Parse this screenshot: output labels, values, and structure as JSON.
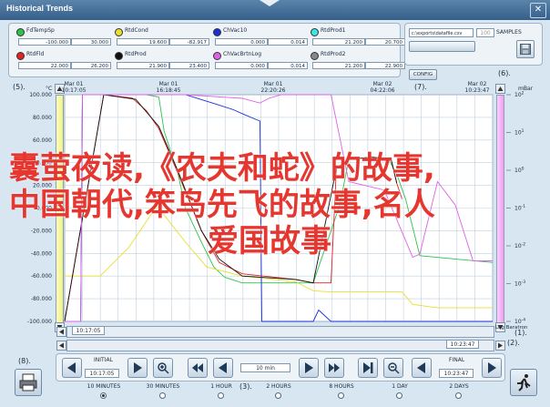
{
  "window": {
    "title": "Historical Trends",
    "close_glyph": "✕"
  },
  "pens": [
    {
      "name": "FdTempSp",
      "color": "#2cc44a",
      "v1": "-100.000",
      "v2": "30.000"
    },
    {
      "name": "RtdCond",
      "color": "#e8e02c",
      "v1": "19.600",
      "v2": "-82.917"
    },
    {
      "name": "ChVac10",
      "color": "#1c2fd6",
      "v1": "0.000",
      "v2": "0.014"
    },
    {
      "name": "RtdProd1",
      "color": "#3de4e4",
      "v1": "21.200",
      "v2": "20.700"
    },
    {
      "name": "RtdFld",
      "color": "#e02424",
      "v1": "22.000",
      "v2": "26.200"
    },
    {
      "name": "RtdProd",
      "color": "#111111",
      "v1": "21.900",
      "v2": "23.400"
    },
    {
      "name": "ChVacBrtnLog",
      "color": "#e060e8",
      "v1": "0.000",
      "v2": "0.014"
    },
    {
      "name": "RtdProd2",
      "color": "#888888",
      "v1": "21.200",
      "v2": "22.900"
    }
  ],
  "export": {
    "path": "c:\\exports\\datafile.csv",
    "samples_value": "100",
    "samples_label": "SAMPLES"
  },
  "config_label": "CONFIG",
  "callouts": {
    "c1": "(1).",
    "c2": "(2).",
    "c3": "(3).",
    "c5": "(5).",
    "c6": "(6).",
    "c7": "(7).",
    "c8": "(8)."
  },
  "chart_data": {
    "type": "line",
    "left_axis": {
      "unit": "°C",
      "ticks": [
        "100.000",
        "80.000",
        "60.000",
        "40.000",
        "20.000",
        "0.000",
        "-20.000",
        "-40.000",
        "-60.000",
        "-80.000",
        "-100.000"
      ],
      "ylim": [
        -100,
        100
      ]
    },
    "right_axis": {
      "unit": "mBar",
      "scale": "log",
      "ticks": [
        "10^2",
        "10^1",
        "10^0",
        "10^-1",
        "10^-2",
        "10^-3",
        "10^-4"
      ],
      "ylim": [
        0.0001,
        100
      ],
      "mode_label": "Log Baratron"
    },
    "time_ticks": [
      {
        "date": "Mar 01",
        "time": "10:17:05"
      },
      {
        "date": "Mar 01",
        "time": "16:18:45"
      },
      {
        "date": "Mar 01",
        "time": "22:20:26"
      },
      {
        "date": "Mar 02",
        "time": "04:22:06"
      },
      {
        "date": "Mar 02",
        "time": "10:23:47"
      }
    ],
    "grid": true,
    "series": [
      {
        "name": "FdTempSp",
        "color": "#2cc44a",
        "axis": "left",
        "x": [
          0,
          0.3,
          0.6,
          0.9,
          1.0,
          2.2,
          3.4,
          4.6,
          5.3,
          5.6,
          6.4,
          6.8,
          7.7,
          8.4,
          9.0,
          10.0,
          13.1,
          14.0,
          15.5,
          16.0,
          17.3,
          18.2,
          18.7,
          19.2,
          20.0,
          24.1
        ],
        "values": [
          -100,
          -100,
          -100,
          -100,
          100,
          100,
          100,
          100,
          98,
          68,
          29,
          0,
          -30,
          -52,
          -61,
          -66,
          -66,
          -66,
          3,
          43,
          45,
          44,
          30,
          8,
          -42,
          -48
        ]
      },
      {
        "name": "RtdCond",
        "color": "#e8e02c",
        "axis": "left",
        "x": [
          0,
          2.0,
          3.6,
          5.2,
          6.8,
          8.0,
          10.0,
          13.0,
          14.0,
          15.0,
          17.0,
          19.0,
          19.6,
          21.0,
          24.1
        ],
        "values": [
          -60,
          -60,
          -35,
          2,
          -30,
          -52,
          -60,
          -65,
          -73,
          -74,
          -74,
          -74,
          -85,
          -88,
          -88
        ]
      },
      {
        "name": "RtdFld",
        "color": "#e02424",
        "axis": "left",
        "x": [
          0,
          2.2,
          3.8,
          4.6,
          5.3,
          6.4,
          7.7,
          8.7,
          10.0,
          13.0,
          14.0,
          15.0,
          15.3,
          16.0,
          17.3,
          18.4,
          18.7,
          19.0
        ],
        "values": [
          -100,
          100,
          97,
          86,
          70,
          30,
          -20,
          -48,
          -58,
          -63,
          -66,
          -66,
          35,
          43,
          45,
          42,
          22,
          8
        ]
      },
      {
        "name": "RtdProd",
        "color": "#111111",
        "axis": "left",
        "x": [
          0,
          2.2,
          4.0,
          5.3,
          6.4,
          7.7,
          8.7,
          10.0,
          13.0,
          14.0,
          15.3,
          16.0,
          17.3,
          18.4,
          18.7
        ],
        "values": [
          -100,
          100,
          96,
          72,
          32,
          -20,
          -45,
          -60,
          -63,
          -66,
          35,
          43,
          45,
          42,
          22
        ]
      },
      {
        "name": "ChVac10",
        "color": "#1c2fd6",
        "axis": "right",
        "x": [
          0,
          0.9,
          1.0,
          2.0,
          6.8,
          8.6,
          9.5,
          10.1,
          11.0,
          11.1,
          11.4,
          13.4,
          14.0,
          14.3,
          15.0,
          20.0,
          22.0,
          24.1
        ],
        "values": [
          0.0001,
          0.0001,
          100,
          100,
          100,
          55,
          40,
          30,
          20,
          0.0001,
          0.0001,
          0.0001,
          0.0001,
          0.0002,
          0.0001,
          0.0001,
          0.0001,
          0.0001
        ]
      },
      {
        "name": "ChVacBrtnLog",
        "color": "#e060e8",
        "axis": "right",
        "x": [
          0,
          0.9,
          1.0,
          2.0,
          6.8,
          10.0,
          11.0,
          11.5,
          12.2,
          13.0,
          14.0,
          15.0,
          16.0,
          18.0,
          19.6,
          20.0,
          21.0,
          22.0,
          23.0,
          24.1
        ],
        "values": [
          0.0001,
          0.0001,
          100,
          100,
          100,
          80,
          60,
          80,
          100,
          100,
          100,
          100,
          0.5,
          0.3,
          0.005,
          0.006,
          0.5,
          0.12,
          0.004,
          0.004
        ]
      }
    ]
  },
  "nav": {
    "initial_label": "INITIAL",
    "initial_time": "10:17:05",
    "final_label": "FINAL",
    "final_time": "10:23:47",
    "interval": "10 min",
    "scroll_start": "10:17:05",
    "scroll_end": "10:23:47"
  },
  "ranges": [
    {
      "label": "10 MINUTES",
      "selected": true
    },
    {
      "label": "30 MINUTES",
      "selected": false
    },
    {
      "label": "1 HOUR",
      "selected": false
    },
    {
      "label": "2 HOURS",
      "selected": false
    },
    {
      "label": "8 HOURS",
      "selected": false
    },
    {
      "label": "1 DAY",
      "selected": false
    },
    {
      "label": "2 DAYS",
      "selected": false
    }
  ],
  "overlay": {
    "line1": "囊萤夜读,《农夫和蛇》的故事,",
    "line2": "中国朝代,笨鸟先飞的故事,名人",
    "line3": "爱国故事"
  }
}
